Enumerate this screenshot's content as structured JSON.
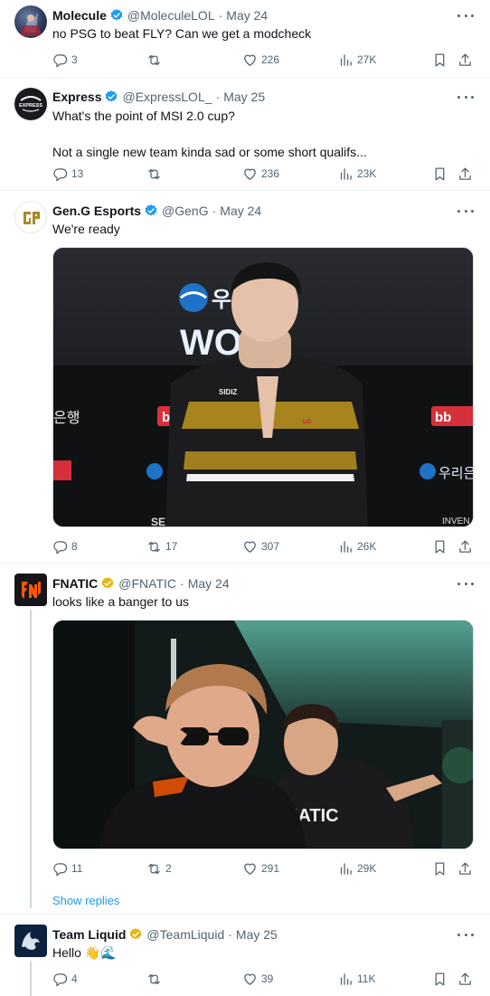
{
  "tweets": [
    {
      "name": "Molecule",
      "handle": "@MoleculeLOL",
      "date": "May 24",
      "text": "no PSG to beat FLY? Can we get a modcheck",
      "replies": "3",
      "retweets": "",
      "likes": "226",
      "views": "27K",
      "badge": "blue"
    },
    {
      "name": "Express",
      "handle": "@ExpressLOL_",
      "date": "May 25",
      "text": "What's the point of MSI 2.0 cup?\n\nNot a single new team kinda sad or some short qualifs...",
      "replies": "13",
      "retweets": "",
      "likes": "236",
      "views": "23K",
      "badge": "blue"
    },
    {
      "name": "Gen.G Esports",
      "handle": "@GenG",
      "date": "May 24",
      "text": "We're ready",
      "replies": "8",
      "retweets": "17",
      "likes": "307",
      "views": "26K",
      "badge": "blue",
      "media": {
        "sponsor_text": "우리",
        "sponsor_text_2": "WO",
        "sponsor_text_3": "우리은",
        "bank_text": "은행",
        "bb_text": "bb",
        "jersey_text": "SIDIZ",
        "jersey_tag": "LG",
        "bottom_text": "SECRET",
        "bottom_text_2": "INVEN"
      }
    },
    {
      "name": "FNATIC",
      "handle": "@FNATIC",
      "date": "May 24",
      "text": "looks like a banger to us",
      "replies": "11",
      "retweets": "2",
      "likes": "291",
      "views": "29K",
      "badge": "gold",
      "media": {
        "jersey_text": "NATIC"
      }
    },
    {
      "name": "Team Liquid",
      "handle": "@TeamLiquid",
      "date": "May 25",
      "text": "Hello 👋🌊",
      "replies": "4",
      "retweets": "",
      "likes": "39",
      "views": "11K",
      "badge": "gold"
    }
  ],
  "show_replies_label": "Show replies",
  "avatars": {
    "express": "EXPRESS"
  },
  "colors": {
    "verified_blue": "#1d9bf0",
    "verified_gold": "#e2b719",
    "text_secondary": "#536471",
    "link": "#1d9bf0"
  },
  "icons": [
    "reply-icon",
    "retweet-icon",
    "like-icon",
    "views-icon",
    "bookmark-icon",
    "share-icon",
    "more-icon",
    "verified-badge-icon"
  ]
}
